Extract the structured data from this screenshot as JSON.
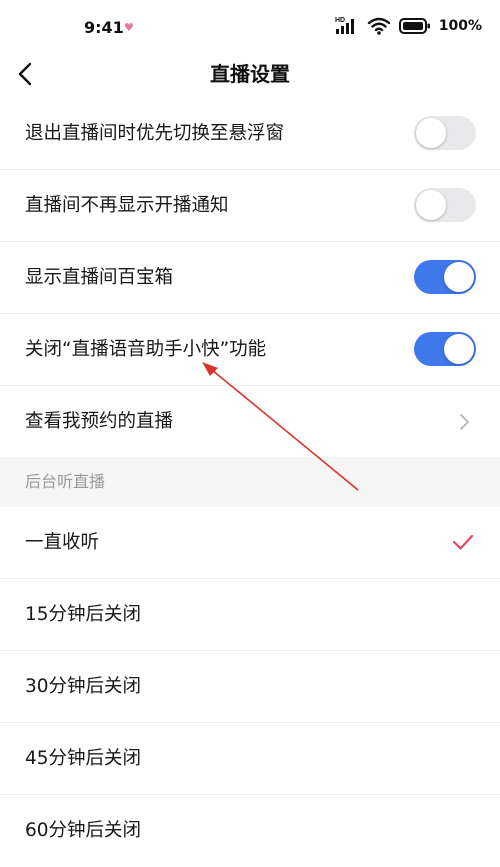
{
  "status_bar": {
    "time": "9:41",
    "battery_percent": "100%",
    "network_label": "HD"
  },
  "nav": {
    "title": "直播设置"
  },
  "settings": [
    {
      "label": "退出直播间时优先切换至悬浮窗",
      "control": "toggle",
      "enabled": false
    },
    {
      "label": "直播间不再显示开播通知",
      "control": "toggle",
      "enabled": false
    },
    {
      "label": "显示直播间百宝箱",
      "control": "toggle",
      "enabled": true
    },
    {
      "label": "关闭“直播语音助手小快”功能",
      "control": "toggle",
      "enabled": true
    },
    {
      "label": "查看我预约的直播",
      "control": "chevron"
    }
  ],
  "background_listen": {
    "header": "后台听直播",
    "options": [
      {
        "label": "一直收听",
        "selected": true
      },
      {
        "label": "15分钟后关闭",
        "selected": false
      },
      {
        "label": "30分钟后关闭",
        "selected": false
      },
      {
        "label": "45分钟后关闭",
        "selected": false
      },
      {
        "label": "60分钟后关闭",
        "selected": false
      }
    ]
  },
  "colors": {
    "toggle_on": "#3f78ea",
    "toggle_off": "#e9e9eb",
    "check_mark": "#e0486a",
    "annotation_arrow": "#d9342b"
  },
  "icons": {
    "back": "chevron-left-icon",
    "chevron": "chevron-right-icon",
    "check": "check-icon"
  }
}
